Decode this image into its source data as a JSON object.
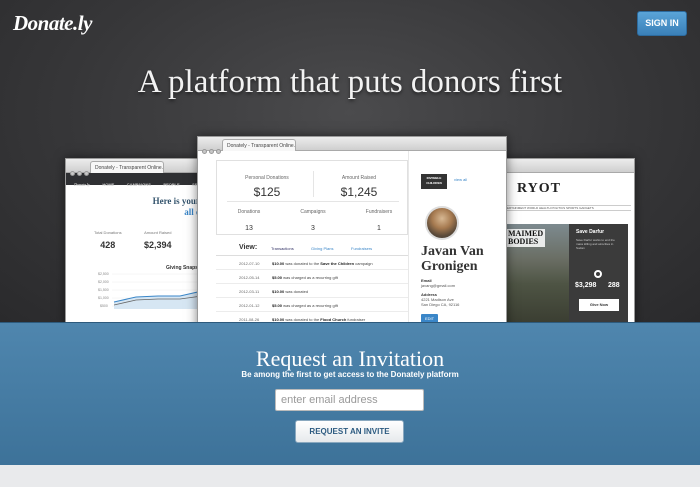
{
  "header": {
    "logo": "Donate.ly",
    "signin_label": "SIGN IN",
    "headline": "A platform that puts donors first"
  },
  "left_window": {
    "tab": "Donately - Transparent Online...",
    "nav": [
      "HOME",
      "CAMPAIGNS",
      "PEOPLE",
      "SETTINGS"
    ],
    "title_line1": "Here is your",
    "title_accent": "weekl",
    "title_line2": "all campai",
    "stats": [
      {
        "label": "Total Donations",
        "value": "428"
      },
      {
        "label": "Amount Raised",
        "value": "$2,394"
      }
    ],
    "chart_title": "Giving Snaps",
    "chart_ticks": [
      "$2,500",
      "$2,000",
      "$1,500",
      "$1,000",
      "$500"
    ]
  },
  "center_window": {
    "tab": "Donately - Transparent Online...",
    "personal_donations_label": "Personal Donations",
    "personal_donations": "$125",
    "amount_raised_label": "Amount Raised",
    "amount_raised": "$1,245",
    "donations_label": "Donations",
    "donations": "13",
    "campaigns_label": "Campaigns",
    "campaigns": "3",
    "fundraisers_label": "Fundraisers",
    "fundraisers": "1",
    "view_label": "View:",
    "view_tabs": [
      "Transactions",
      "Giving Plans",
      "Fundraisers"
    ],
    "transactions": [
      {
        "date": "2012-07-10",
        "amount": "$10.00",
        "text": "was donated to the",
        "target": "Save the Children",
        "suffix": "campaign"
      },
      {
        "date": "2012-05-14",
        "amount": "$5.00",
        "text": "was charged as a recurring gift",
        "target": "",
        "suffix": ""
      },
      {
        "date": "2012-03-11",
        "amount": "$10.00",
        "text": "was donated",
        "target": "",
        "suffix": ""
      },
      {
        "date": "2012-01-12",
        "amount": "$5.00",
        "text": "was charged as a recurring gift",
        "target": "",
        "suffix": ""
      },
      {
        "date": "2011-08-26",
        "amount": "$10.00",
        "text": "was donated to the",
        "target": "Flood Church",
        "suffix": "fundraiser"
      }
    ],
    "profile": {
      "badge": "INVISIBLE CHILDREN",
      "view_all": "view all",
      "name_line1": "Javan Van",
      "name_line2": "Gronigen",
      "email_label": "Email",
      "email": "javang@gmail.com",
      "address_label": "Address",
      "address_line1": "4221 Madison Ave",
      "address_line2": "San Diego CA, 92116",
      "edit_label": "EDIT"
    }
  },
  "right_window": {
    "brand": "RYOT",
    "nav": "ENTERTAINMENT  WORLD  HEALTH  POLITICS  SPORTS  GADGETS",
    "story_title_1": "MAIMED",
    "story_title_2": "BODIES",
    "panel_title": "Save Darfur",
    "panel_text": "Save Darfur works to end the mass killing and atrocities in Sudan",
    "amount": "$3,298",
    "count": "288",
    "give_label": "Give Now"
  },
  "invite": {
    "title": "Request an Invitation",
    "subtitle": "Be among the first to get access to the Donately platform",
    "email_placeholder": "enter email address",
    "button_label": "REQUEST AN INVITE"
  },
  "colors": {
    "accent": "#3a86c8",
    "hero_bg": "#3a3a3c",
    "band_bg": "#4a80a8"
  }
}
